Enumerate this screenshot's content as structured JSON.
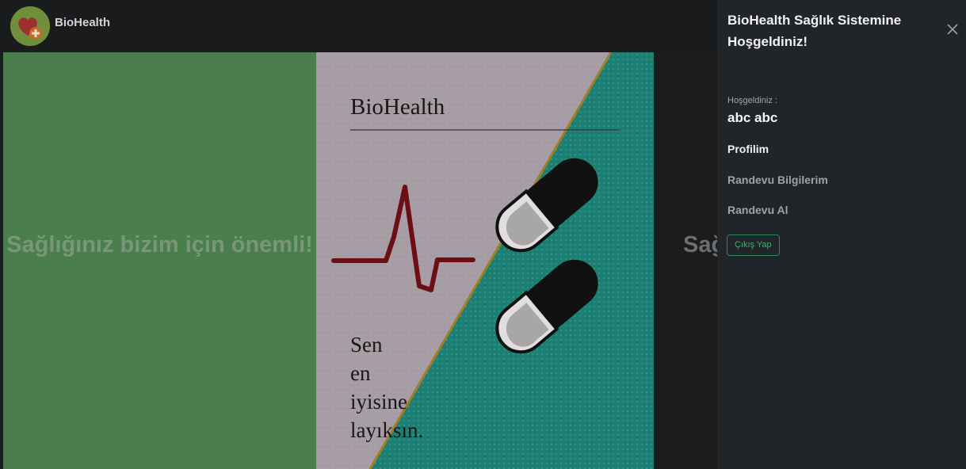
{
  "navbar": {
    "brand": "BioHealth"
  },
  "carousel": {
    "left_slide_text": "Sağlığınız bizim için önemli!",
    "right_slide_text": "Sağ",
    "poster": {
      "title": "BioHealth",
      "slogan_lines": [
        "Sen",
        "en",
        "iyisine",
        "layıksın."
      ],
      "colors": {
        "background_left": "#a59ca4",
        "background_right": "#1d7e73",
        "heartbeat": "#6b0f15",
        "diagonal": "#a07e23"
      }
    }
  },
  "offcanvas": {
    "title": "BioHealth Sağlık Sistemine Hoşgeldiniz!",
    "close_icon": "close-icon",
    "welcome_label": "Hoşgeldiniz :",
    "username": "abc abc",
    "links": [
      {
        "label": "Profilim",
        "active": true
      },
      {
        "label": "Randevu Bilgilerim",
        "active": false
      },
      {
        "label": "Randevu Al",
        "active": false
      }
    ],
    "logout_label": "Çıkış Yap"
  },
  "colors": {
    "navbar_bg": "#1a1b1d",
    "offcanvas_bg": "#212529",
    "logout_border": "#2e8a57",
    "left_slide_bg": "#4b7e4d"
  }
}
